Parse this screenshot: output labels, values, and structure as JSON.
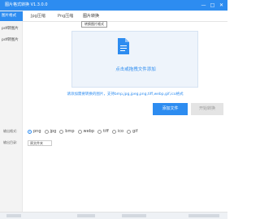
{
  "window": {
    "title": "图片格式转换 V1.3.0.0",
    "controls": [
      "—",
      "□",
      "✕"
    ]
  },
  "sidebar": {
    "items": [
      {
        "label": "图片格式"
      },
      {
        "label": "pdf转图片"
      },
      {
        "label": "pdf转图片"
      }
    ]
  },
  "tabs": [
    {
      "label": "Jpg压缩"
    },
    {
      "label": "Png压缩"
    },
    {
      "label": "图片转换"
    }
  ],
  "tooltip": "转换图片格式",
  "dropzone": {
    "text": "点击或拖拽文件添加"
  },
  "hint": "请添加需要转换的图片，支持bmp,jpg,jpeg,png,tiff,webp,gif,ico格式",
  "buttons": {
    "add": "添加文件",
    "start": "开始转换"
  },
  "output_format": {
    "label": "输出格式:",
    "options": [
      "png",
      "jpg",
      "bmp",
      "webp",
      "tiff",
      "ico",
      "gif"
    ],
    "selected": "png"
  },
  "output_dir": {
    "label": "输出目录:",
    "value": "原文件夹"
  },
  "colors": {
    "accent": "#2d8cf0",
    "dropzone_bg": "#eef4fb",
    "disabled_bg": "#e4e4e4"
  }
}
